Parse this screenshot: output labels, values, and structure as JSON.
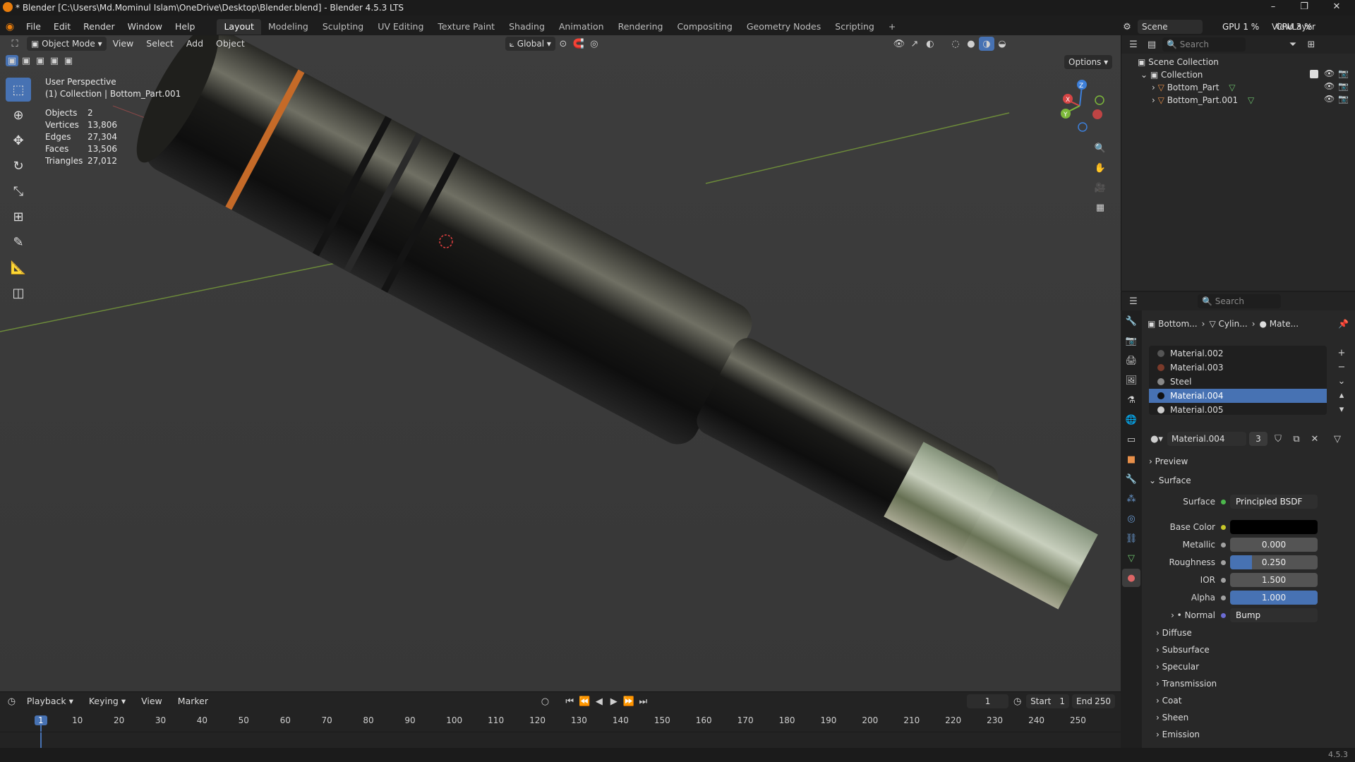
{
  "window": {
    "title": "* Blender [C:\\Users\\Md.Mominul Islam\\OneDrive\\Desktop\\Blender.blend] - Blender 4.5.3 LTS"
  },
  "menu": [
    "File",
    "Edit",
    "Render",
    "Window",
    "Help"
  ],
  "workspaces": [
    "Layout",
    "Modeling",
    "Sculpting",
    "UV Editing",
    "Texture Paint",
    "Shading",
    "Animation",
    "Rendering",
    "Compositing",
    "Geometry Nodes",
    "Scripting"
  ],
  "topright": {
    "scene": "Scene",
    "view_layer": "ViewLayer",
    "gpu_label": "GPU",
    "gpu_val": "1 %",
    "cpu_label": "CPU",
    "cpu_val": "3 %"
  },
  "viewport_header": {
    "mode": "Object Mode",
    "view": "View",
    "select": "Select",
    "add": "Add",
    "object": "Object",
    "orientation": "Global",
    "options": "Options"
  },
  "overlay": {
    "perspective": "User Perspective",
    "collection_line": "(1) Collection | Bottom_Part.001"
  },
  "stats": [
    {
      "k": "Objects",
      "v": "2"
    },
    {
      "k": "Vertices",
      "v": "13,806"
    },
    {
      "k": "Edges",
      "v": "27,304"
    },
    {
      "k": "Faces",
      "v": "13,506"
    },
    {
      "k": "Triangles",
      "v": "27,012"
    }
  ],
  "gizmo": {
    "x": "X",
    "y": "Y",
    "z": "Z"
  },
  "outliner": {
    "search_placeholder": "Search",
    "scene_collection": "Scene Collection",
    "collection": "Collection",
    "items": [
      "Bottom_Part",
      "Bottom_Part.001"
    ]
  },
  "properties": {
    "search_placeholder": "Search",
    "breadcrumb": [
      "Bottom...",
      "Cylin...",
      "Mate..."
    ],
    "slots": [
      "Material.002",
      "Material.003",
      "Steel",
      "Material.004",
      "Material.005"
    ],
    "active_material": "Material.004",
    "users": "3",
    "panels": {
      "preview": "Preview",
      "surface": "Surface"
    },
    "surface_label": "Surface",
    "surface_value": "Principled BSDF",
    "fields": [
      {
        "label": "Base Color",
        "value": "",
        "fill": 0,
        "color": "#000000"
      },
      {
        "label": "Metallic",
        "value": "0.000",
        "fill": 0
      },
      {
        "label": "Roughness",
        "value": "0.250",
        "fill": 0.25
      },
      {
        "label": "IOR",
        "value": "1.500",
        "fill": 0
      },
      {
        "label": "Alpha",
        "value": "1.000",
        "fill": 1
      }
    ],
    "normal_label": "Normal",
    "normal_value": "Bump",
    "subpanels": [
      "Diffuse",
      "Subsurface",
      "Specular",
      "Transmission",
      "Coat",
      "Sheen",
      "Emission"
    ]
  },
  "timeline": {
    "playback": "Playback",
    "keying": "Keying",
    "view": "View",
    "marker": "Marker",
    "current_frame": "1",
    "start_label": "Start",
    "start": "1",
    "end_label": "End",
    "end": "250",
    "ticks": [
      "1",
      "10",
      "20",
      "30",
      "40",
      "50",
      "60",
      "70",
      "80",
      "90",
      "100",
      "110",
      "120",
      "130",
      "140",
      "150",
      "160",
      "170",
      "180",
      "190",
      "200",
      "210",
      "220",
      "230",
      "240",
      "250"
    ]
  },
  "status": {
    "version": "4.5.3"
  }
}
